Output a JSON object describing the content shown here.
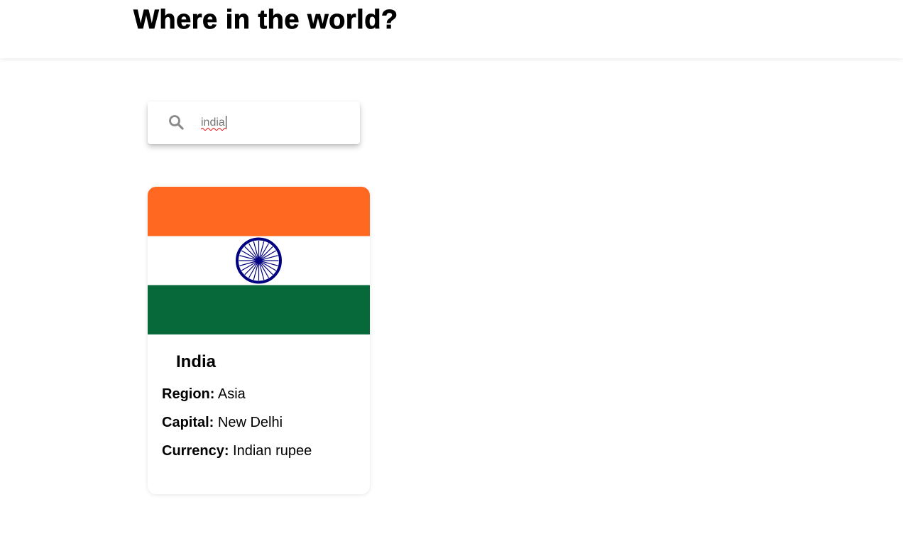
{
  "header": {
    "title": "Where in the world?"
  },
  "search": {
    "value": "india",
    "icon": "search-icon"
  },
  "colors": {
    "saffron": "#FF6820",
    "white": "#FFFFFF",
    "green": "#07693A",
    "chakra_blue": "#000080"
  },
  "card": {
    "name": "India",
    "region_label": "Region:",
    "region": "Asia",
    "capital_label": "Capital:",
    "capital": "New Delhi",
    "currency_label": "Currency:",
    "currency": "Indian rupee"
  }
}
